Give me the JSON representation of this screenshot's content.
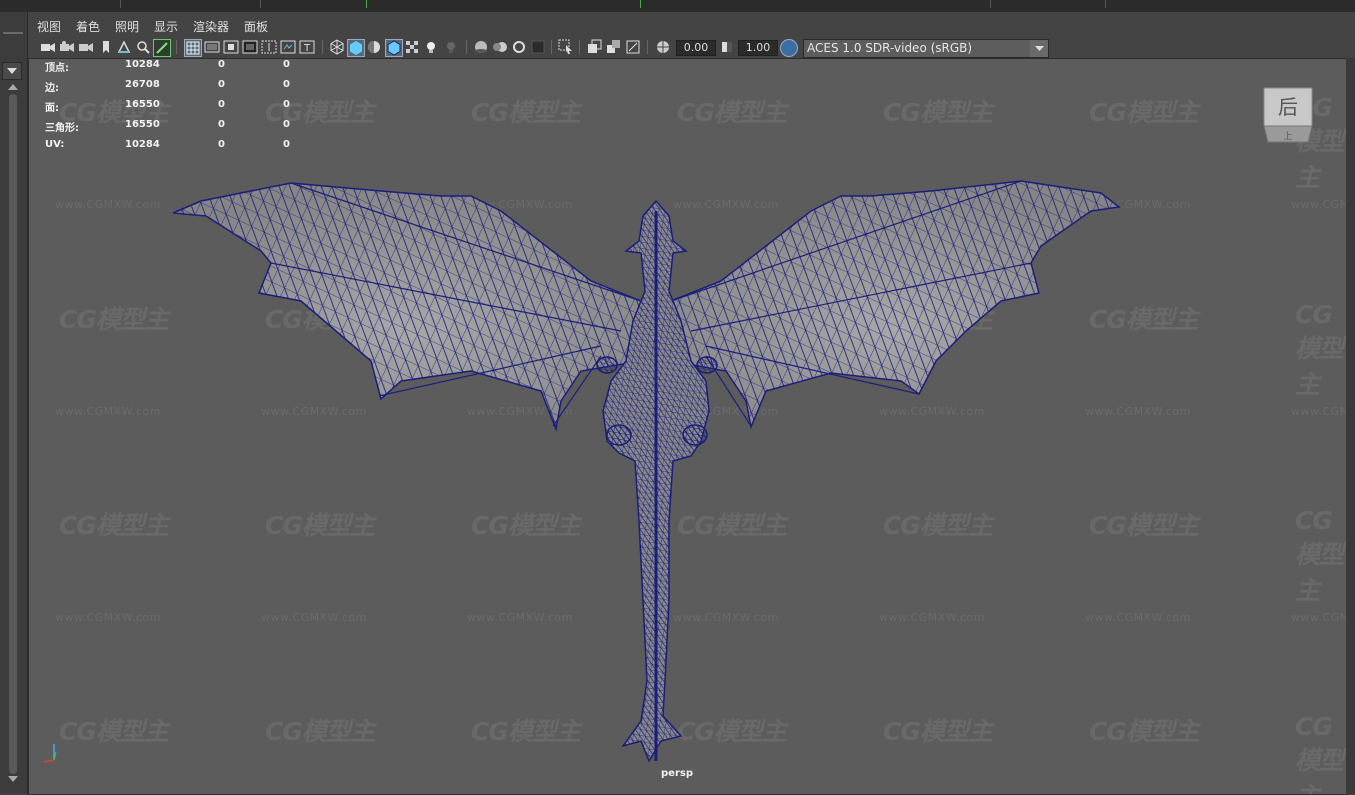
{
  "menu": {
    "items": [
      "视图",
      "着色",
      "照明",
      "显示",
      "渲染器",
      "面板"
    ]
  },
  "toolbar": {
    "exposure": "0.00",
    "gamma": "1.00",
    "color_space": "ACES 1.0 SDR-video (sRGB)",
    "icons": [
      "camera-select-icon",
      "camera-attributes-icon",
      "bookmark-icon",
      "image-plane-icon",
      "2d-pan-zoom-icon",
      "grease-pencil-icon",
      "grid-icon",
      "film-gate-icon",
      "resolution-gate-icon",
      "gate-mask-icon",
      "field-chart-icon",
      "safe-action-icon",
      "safe-title-icon",
      "wireframe-icon",
      "smooth-shade-icon",
      "use-default-material-icon",
      "wireframe-on-shaded-icon",
      "xray-icon",
      "xray-joints-icon",
      "lighting-icon",
      "shadows-icon",
      "screen-space-ao-icon",
      "motion-blur-icon",
      "anti-aliasing-icon",
      "depth-of-field-icon",
      "isolate-select-icon",
      "highlight-icon",
      "exposure-icon",
      "gamma-icon",
      "color-management-icon"
    ]
  },
  "hud": {
    "rows": [
      {
        "label": "顶点:",
        "a": "10284",
        "b": "0",
        "c": "0"
      },
      {
        "label": "边:",
        "a": "26708",
        "b": "0",
        "c": "0"
      },
      {
        "label": "面:",
        "a": "16550",
        "b": "0",
        "c": "0"
      },
      {
        "label": "三角形:",
        "a": "16550",
        "b": "0",
        "c": "0"
      },
      {
        "label": "UV:",
        "a": "10284",
        "b": "0",
        "c": "0"
      }
    ]
  },
  "watermark": {
    "logo": "CG模型主",
    "url": "www.CGMXW.com"
  },
  "viewcube": {
    "face_label": "后",
    "top_label": "上"
  },
  "camera_name": "persp",
  "colors": {
    "viewport_bg": "#5c5c5c",
    "wireframe": "#1b1f7a",
    "mesh_shade": "#9a9a9a",
    "ui_bg": "#444444",
    "accent_active": "#4ea3d6"
  }
}
